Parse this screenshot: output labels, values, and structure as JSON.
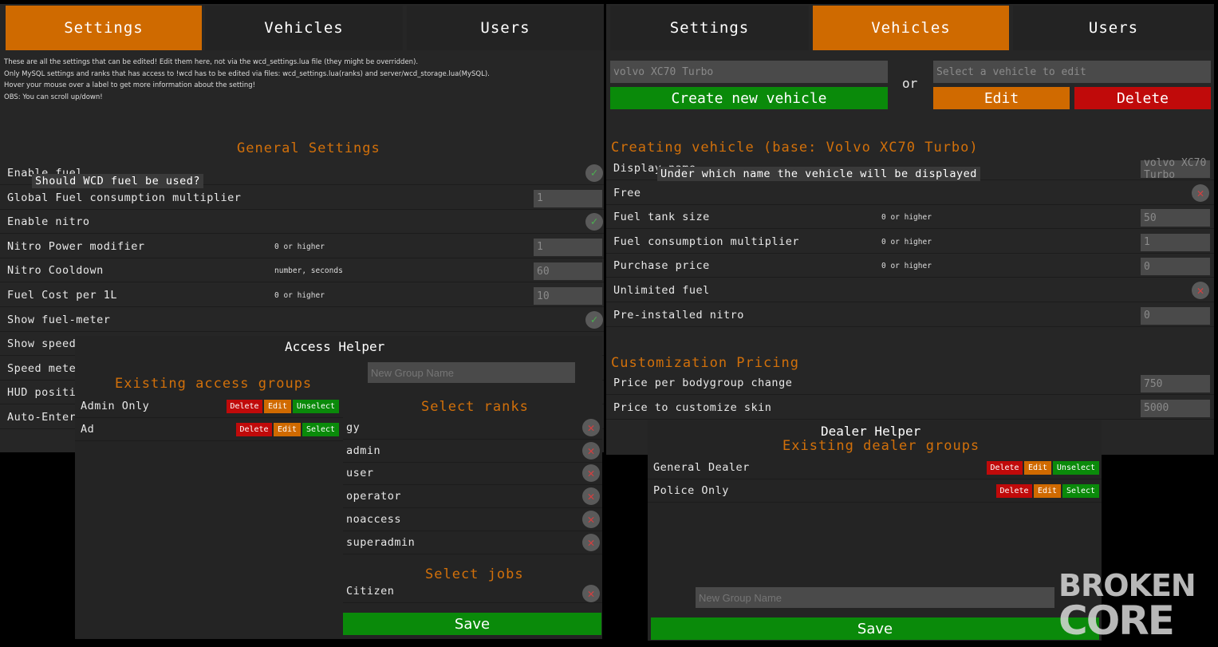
{
  "left": {
    "tabs": [
      "Settings",
      "Vehicles",
      "Users"
    ],
    "info": [
      "These are all the settings that can be edited! Edit them here, not via the wcd_settings.lua file (they might be overridden).",
      "Only MySQL settings and ranks that has access to !wcd has to be edited via files: wcd_settings.lua(ranks) and server/wcd_storage.lua(MySQL).",
      "Hover your mouse over a label to get more information about the setting!",
      "OBS: You can scroll up/down!"
    ],
    "heading": "General Settings",
    "tooltip": "Should WCD fuel be used?",
    "rows": [
      {
        "label": "Enable fuel",
        "type": "check"
      },
      {
        "label": "Global Fuel consumption multiplier",
        "value": "1"
      },
      {
        "label": "Enable nitro",
        "type": "check"
      },
      {
        "label": "Nitro Power modifier",
        "hint": "0 or higher",
        "value": "1"
      },
      {
        "label": "Nitro Cooldown",
        "hint": "number, seconds",
        "value": "60"
      },
      {
        "label": "Fuel Cost per 1L",
        "hint": "0 or higher",
        "value": "10"
      },
      {
        "label": "Show fuel-meter",
        "type": "check"
      },
      {
        "label": "Show speed"
      },
      {
        "label": "Speed mete"
      },
      {
        "label": "HUD positi"
      },
      {
        "label": "Auto-Enter"
      }
    ]
  },
  "access": {
    "title": "Access Helper",
    "new_group_placeholder": "New Group Name",
    "groups_heading": "Existing access groups",
    "groups": [
      {
        "name": "Admin Only",
        "toggle": "Unselect"
      },
      {
        "name": "Ad",
        "toggle": "Select"
      }
    ],
    "delete": "Delete",
    "edit": "Edit",
    "ranks_heading": "Select ranks",
    "ranks": [
      "gy",
      "admin",
      "user",
      "operator",
      "noaccess",
      "superadmin"
    ],
    "jobs_heading": "Select jobs",
    "jobs": [
      "Citizen"
    ],
    "save": "Save"
  },
  "right": {
    "tabs": [
      "Settings",
      "Vehicles",
      "Users"
    ],
    "base_input": "volvo XC70 Turbo",
    "or": "or",
    "select_placeholder": "Select a vehicle to edit",
    "create": "Create new vehicle",
    "edit": "Edit",
    "delete": "Delete",
    "heading": "Creating vehicle (base: Volvo XC70 Turbo)",
    "tooltip": "Under which name the vehicle will be displayed",
    "rows": [
      {
        "label": "Display name",
        "value": "volvo XC70 Turbo"
      },
      {
        "label": "Free",
        "type": "x"
      },
      {
        "label": "Fuel tank size",
        "hint": "0 or higher",
        "value": "50"
      },
      {
        "label": "Fuel consumption multiplier",
        "hint": "0 or higher",
        "value": "1"
      },
      {
        "label": "Purchase price",
        "hint": "0 or higher",
        "value": "0"
      },
      {
        "label": "Unlimited fuel",
        "type": "x"
      },
      {
        "label": "Pre-installed nitro",
        "value": "0"
      }
    ],
    "custom_heading": "Customization Pricing",
    "custom_rows": [
      {
        "label": "Price per bodygroup change",
        "value": "750"
      },
      {
        "label": "Price to customize skin",
        "value": "5000"
      }
    ]
  },
  "dealer": {
    "title": "Dealer Helper",
    "groups_heading": "Existing dealer groups",
    "groups": [
      {
        "name": "General Dealer",
        "toggle": "Unselect"
      },
      {
        "name": "Police Only",
        "toggle": "Select"
      }
    ],
    "delete": "Delete",
    "edit": "Edit",
    "new_group_placeholder": "New Group Name",
    "save": "Save"
  },
  "logo": {
    "text": [
      "BROKEN",
      "CORE"
    ]
  },
  "colors": {
    "accent": "#cf6a00",
    "panel": "#262626",
    "green": "#0a8a0a",
    "red": "#c00a0a"
  }
}
